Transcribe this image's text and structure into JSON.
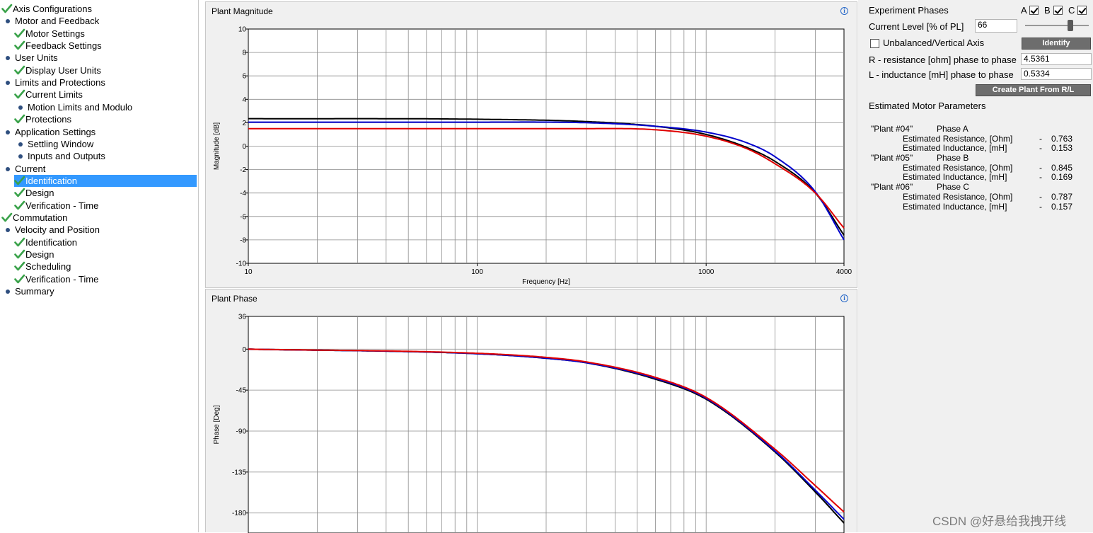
{
  "tree": {
    "items": [
      {
        "label": "Axis Configurations",
        "icon": "check-icon",
        "indent": 0,
        "selected": false
      },
      {
        "label": "Motor and Feedback",
        "icon": "dot-icon",
        "indent": 0,
        "selected": false
      },
      {
        "label": "Motor Settings",
        "icon": "check-icon",
        "indent": 1,
        "selected": false
      },
      {
        "label": "Feedback Settings",
        "icon": "check-icon",
        "indent": 1,
        "selected": false
      },
      {
        "label": "User Units",
        "icon": "dot-icon",
        "indent": 0,
        "selected": false
      },
      {
        "label": "Display User Units",
        "icon": "check-icon",
        "indent": 1,
        "selected": false
      },
      {
        "label": "Limits and Protections",
        "icon": "dot-icon",
        "indent": 0,
        "selected": false
      },
      {
        "label": "Current Limits",
        "icon": "check-icon",
        "indent": 1,
        "selected": false
      },
      {
        "label": "Motion Limits and Modulo",
        "icon": "dot-icon",
        "indent": 1,
        "selected": false
      },
      {
        "label": "Protections",
        "icon": "check-icon",
        "indent": 1,
        "selected": false
      },
      {
        "label": "Application Settings",
        "icon": "dot-icon",
        "indent": 0,
        "selected": false
      },
      {
        "label": "Settling Window",
        "icon": "dot-icon",
        "indent": 1,
        "selected": false
      },
      {
        "label": "Inputs and Outputs",
        "icon": "dot-icon",
        "indent": 1,
        "selected": false
      },
      {
        "label": "Current",
        "icon": "dot-icon",
        "indent": 0,
        "selected": false
      },
      {
        "label": "Identification",
        "icon": "check-icon",
        "indent": 1,
        "selected": true
      },
      {
        "label": "Design",
        "icon": "check-icon",
        "indent": 1,
        "selected": false
      },
      {
        "label": "Verification - Time",
        "icon": "check-icon",
        "indent": 1,
        "selected": false
      },
      {
        "label": "Commutation",
        "icon": "check-icon",
        "indent": 0,
        "selected": false
      },
      {
        "label": "Velocity and Position",
        "icon": "dot-icon",
        "indent": 0,
        "selected": false
      },
      {
        "label": "Identification",
        "icon": "check-icon",
        "indent": 1,
        "selected": false
      },
      {
        "label": "Design",
        "icon": "check-icon",
        "indent": 1,
        "selected": false
      },
      {
        "label": "Scheduling",
        "icon": "check-icon",
        "indent": 1,
        "selected": false
      },
      {
        "label": "Verification - Time",
        "icon": "check-icon",
        "indent": 1,
        "selected": false
      },
      {
        "label": "Summary",
        "icon": "dot-icon",
        "indent": 0,
        "selected": false
      }
    ]
  },
  "magnitude_panel": {
    "title": "Plant Magnitude",
    "info": "i",
    "ylabel": "Magnitude [dB]",
    "xlabel": "Frequency [Hz]",
    "y_ticks": [
      "10",
      "8",
      "6",
      "4",
      "2",
      "0",
      "-2",
      "-4",
      "-6",
      "-8",
      "-10"
    ],
    "x_ticks": [
      "10",
      "100",
      "1000",
      "4000"
    ]
  },
  "phase_panel": {
    "title": "Plant Phase",
    "info": "i",
    "ylabel": "Phase [Deg]",
    "y_ticks": [
      "36",
      "0",
      "-45",
      "-90",
      "-135",
      "-180"
    ]
  },
  "chart_data": [
    {
      "type": "line",
      "title": "Plant Magnitude",
      "xlabel": "Frequency [Hz]",
      "ylabel": "Magnitude [dB]",
      "x_scale": "log",
      "xlim": [
        10,
        4000
      ],
      "ylim": [
        -10,
        10
      ],
      "grid": true,
      "x": [
        10,
        100,
        300,
        600,
        1000,
        1500,
        2000,
        3000,
        4000
      ],
      "series": [
        {
          "color": "#000000",
          "values": [
            2.35,
            2.3,
            2.1,
            1.7,
            1.0,
            -0.1,
            -1.3,
            -4.0,
            -7.6
          ]
        },
        {
          "color": "#0000cc",
          "values": [
            2.05,
            2.05,
            2.0,
            1.7,
            1.2,
            0.3,
            -0.9,
            -3.9,
            -8.0
          ]
        },
        {
          "color": "#e00000",
          "values": [
            1.5,
            1.5,
            1.5,
            1.4,
            0.85,
            -0.2,
            -1.5,
            -4.0,
            -7.0
          ]
        }
      ]
    },
    {
      "type": "line",
      "title": "Plant Phase",
      "ylabel": "Phase [Deg]",
      "x_scale": "log",
      "xlim": [
        10,
        4000
      ],
      "ylim": [
        -202,
        36
      ],
      "grid": true,
      "x": [
        10,
        100,
        200,
        300,
        600,
        1000,
        2000,
        3000,
        4000
      ],
      "series": [
        {
          "color": "#000000",
          "values": [
            0,
            -5,
            -10,
            -15,
            -33,
            -55,
            -113,
            -157,
            -191
          ]
        },
        {
          "color": "#0000cc",
          "values": [
            0,
            -5,
            -10,
            -15,
            -32,
            -54,
            -112,
            -155,
            -187
          ]
        },
        {
          "color": "#e00000",
          "values": [
            0,
            -4.5,
            -9,
            -14,
            -31,
            -53,
            -110,
            -150,
            -179
          ]
        }
      ]
    }
  ],
  "right_panel": {
    "experiment_phases_label": "Experiment Phases",
    "phase_a_label": "A",
    "phase_b_label": "B",
    "phase_c_label": "C",
    "current_level_label": "Current Level [% of PL]",
    "current_level_value": "66",
    "unbalanced_label": "Unbalanced/Vertical Axis",
    "identify_label": "Identify",
    "r_label": "R - resistance [ohm] phase to phase",
    "r_value": "4.5361",
    "l_label": "L - inductance [mH] phase to phase",
    "l_value": "0.5334",
    "create_plant_label": "Create Plant From R/L",
    "estimated_title": "Estimated Motor Parameters",
    "plants": [
      {
        "name": "\"Plant #04\"",
        "phase": "Phase A",
        "res_label": "Estimated Resistance, [Ohm]",
        "res_dash": "-",
        "res": "0.763",
        "ind_label": "Estimated Inductance, [mH]",
        "ind_dash": "-",
        "ind": "0.153"
      },
      {
        "name": "\"Plant #05\"",
        "phase": "Phase B",
        "res_label": "Estimated Resistance, [Ohm]",
        "res_dash": "-",
        "res": "0.845",
        "ind_label": "Estimated Inductance, [mH]",
        "ind_dash": "-",
        "ind": "0.169"
      },
      {
        "name": "\"Plant #06\"",
        "phase": "Phase C",
        "res_label": "Estimated Resistance, [Ohm]",
        "res_dash": "-",
        "res": "0.787",
        "ind_label": "Estimated Inductance, [mH]",
        "ind_dash": "-",
        "ind": "0.157"
      }
    ]
  },
  "watermark": "CSDN @好悬给我拽开线"
}
